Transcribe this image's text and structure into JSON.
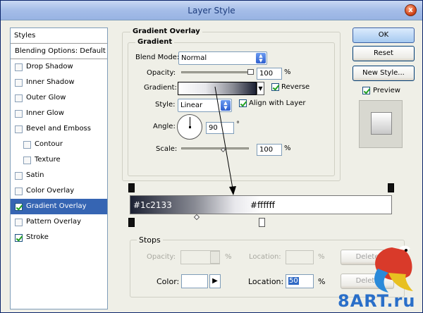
{
  "window": {
    "title": "Layer Style",
    "close_label": "x"
  },
  "styles_panel": {
    "header": "Styles",
    "items": [
      {
        "label": "Blending Options: Default",
        "check": null,
        "sub": false,
        "selected": false
      },
      {
        "label": "Drop Shadow",
        "check": false,
        "sub": false,
        "selected": false
      },
      {
        "label": "Inner Shadow",
        "check": false,
        "sub": false,
        "selected": false
      },
      {
        "label": "Outer Glow",
        "check": false,
        "sub": false,
        "selected": false
      },
      {
        "label": "Inner Glow",
        "check": false,
        "sub": false,
        "selected": false
      },
      {
        "label": "Bevel and Emboss",
        "check": false,
        "sub": false,
        "selected": false
      },
      {
        "label": "Contour",
        "check": false,
        "sub": true,
        "selected": false
      },
      {
        "label": "Texture",
        "check": false,
        "sub": true,
        "selected": false
      },
      {
        "label": "Satin",
        "check": false,
        "sub": false,
        "selected": false
      },
      {
        "label": "Color Overlay",
        "check": false,
        "sub": false,
        "selected": false
      },
      {
        "label": "Gradient Overlay",
        "check": true,
        "sub": false,
        "selected": true
      },
      {
        "label": "Pattern Overlay",
        "check": false,
        "sub": false,
        "selected": false
      },
      {
        "label": "Stroke",
        "check": true,
        "sub": false,
        "selected": false
      }
    ]
  },
  "gradient_overlay": {
    "section_title": "Gradient Overlay",
    "group_title": "Gradient",
    "blend_mode_label": "Blend Mode:",
    "blend_mode_value": "Normal",
    "opacity_label": "Opacity:",
    "opacity_value": "100",
    "opacity_unit": "%",
    "opacity_fraction": 1.0,
    "gradient_label": "Gradient:",
    "reverse_label": "Reverse",
    "reverse_checked": true,
    "style_label": "Style:",
    "style_value": "Linear",
    "align_label": "Align with Layer",
    "align_checked": true,
    "angle_label": "Angle:",
    "angle_value": "90",
    "angle_unit": "°",
    "scale_label": "Scale:",
    "scale_value": "100",
    "scale_unit": "%"
  },
  "buttons": {
    "ok": "OK",
    "reset": "Reset",
    "new_style": "New Style...",
    "preview_label": "Preview",
    "preview_checked": true
  },
  "gradient_editor": {
    "start_color": "#1c2133",
    "end_color": "#ffffff",
    "start_label": "#1c2133",
    "end_label": "#ffffff",
    "stops_title": "Stops",
    "opacity_label": "Opacity:",
    "opacity_unit": "%",
    "location_label": "Location:",
    "location_unit": "%",
    "delete_label": "Delete",
    "color_label": "Color:",
    "color_location_label": "Location:",
    "color_location_value": "50",
    "color_location_unit": "%"
  },
  "watermark": {
    "text": "8ART.ru"
  }
}
